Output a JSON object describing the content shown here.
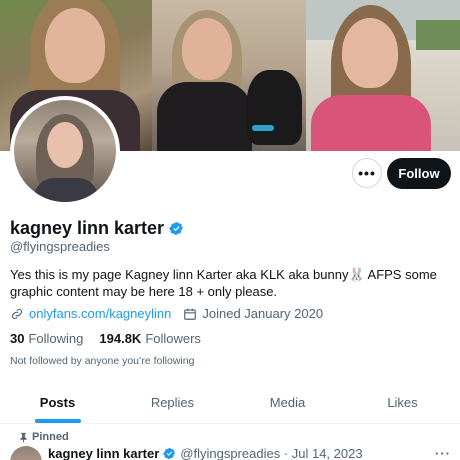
{
  "header": {
    "banner_photos": [
      "banner-photo-1",
      "banner-photo-2",
      "banner-photo-3"
    ]
  },
  "profile": {
    "name": "kagney linn karter",
    "handle": "@flyingspreadies",
    "bio": "Yes this is my page Kagney linn Karter aka KLK aka bunny🐰 AFPS some graphic content may be here 18 + only please.",
    "link": "onlyfans.com/kagneylinn",
    "joined": "Joined January 2020",
    "following_count": "30",
    "following_label": "Following",
    "followers_count": "194.8K",
    "followers_label": "Followers",
    "not_followed": "Not followed by anyone you’re following"
  },
  "actions": {
    "more_label": "•••",
    "follow_label": "Follow"
  },
  "tabs": [
    {
      "label": "Posts",
      "active": true
    },
    {
      "label": "Replies",
      "active": false
    },
    {
      "label": "Media",
      "active": false
    },
    {
      "label": "Likes",
      "active": false
    }
  ],
  "pinned_tweet": {
    "pinned_label": "Pinned",
    "name": "kagney linn karter",
    "meta": "@flyingspreadies · Jul 14, 2023",
    "more_label": "···"
  },
  "colors": {
    "accent": "#1d9bf0",
    "text": "#0f1419",
    "muted": "#536471",
    "button": "#0f1419"
  },
  "icons": [
    "verified-badge-icon",
    "link-icon",
    "calendar-icon",
    "pin-icon",
    "more-icon"
  ]
}
